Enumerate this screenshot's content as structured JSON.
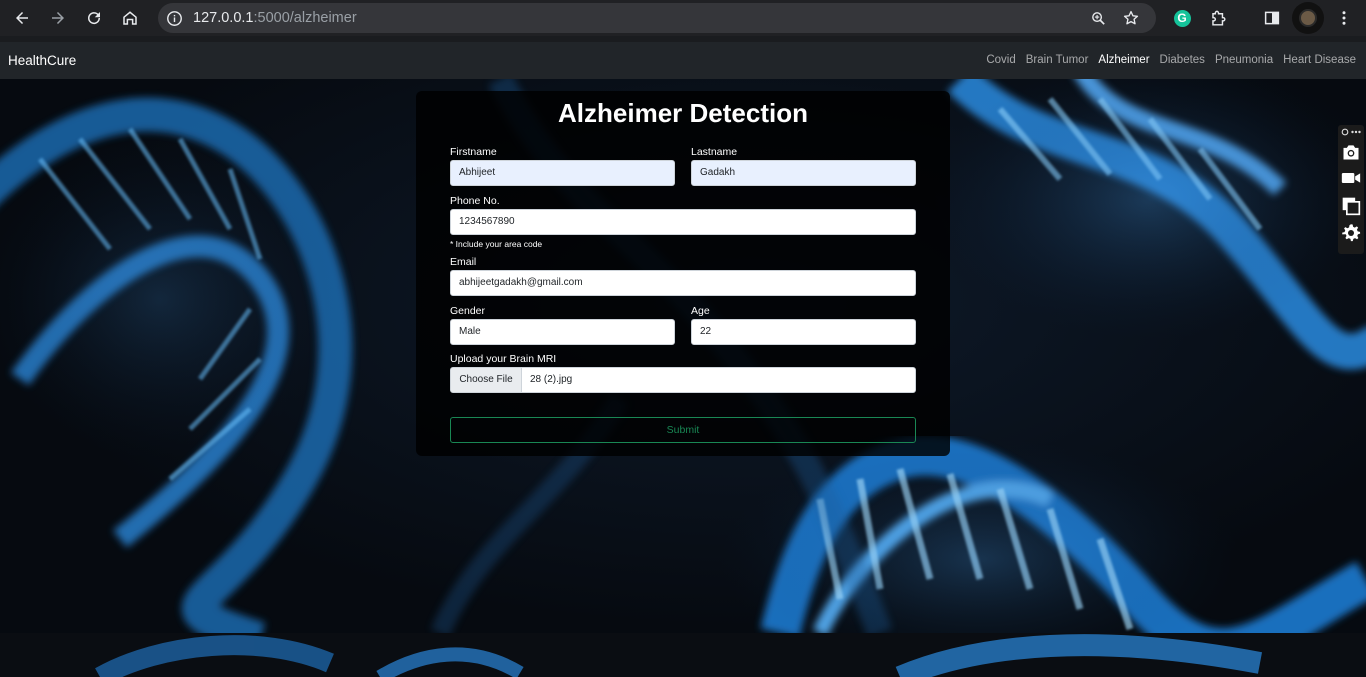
{
  "browser": {
    "url_host": "127.0.0.1",
    "url_path": ":5000/alzheimer",
    "extensions": {
      "grammarly_letter": "G"
    }
  },
  "navbar": {
    "brand": "HealthCure",
    "links": [
      "Covid",
      "Brain Tumor",
      "Alzheimer",
      "Diabetes",
      "Pneumonia",
      "Heart Disease"
    ],
    "active": "Alzheimer"
  },
  "form": {
    "title": "Alzheimer Detection",
    "firstname_label": "Firstname",
    "firstname_value": "Abhijeet",
    "lastname_label": "Lastname",
    "lastname_value": "Gadakh",
    "phone_label": "Phone No.",
    "phone_value": "1234567890",
    "phone_note": "* Include your area code",
    "email_label": "Email",
    "email_value": "abhijeetgadakh@gmail.com",
    "gender_label": "Gender",
    "gender_value": "Male",
    "age_label": "Age",
    "age_value": "22",
    "upload_label": "Upload your Brain MRI",
    "choose_file_label": "Choose File",
    "file_name": "28 (2).jpg",
    "submit_label": "Submit"
  },
  "colors": {
    "chrome_bg": "#202124",
    "navbar_bg": "#212529",
    "submit_accent": "#198754",
    "autofill_bg": "#e8f0fe",
    "dna_blue": "#2f8fe0"
  },
  "icons": {
    "back": "arrow-left-icon",
    "forward": "arrow-right-icon",
    "reload": "reload-icon",
    "home": "home-icon",
    "site_info": "info-icon",
    "zoom": "zoom-icon",
    "bookmark": "star-icon",
    "extensions": "puzzle-icon",
    "side_panel": "side-panel-icon",
    "menu": "kebab-menu-icon",
    "screenshot": "camera-icon",
    "record": "video-camera-icon",
    "copy": "copy-icon",
    "settings": "gear-icon"
  }
}
